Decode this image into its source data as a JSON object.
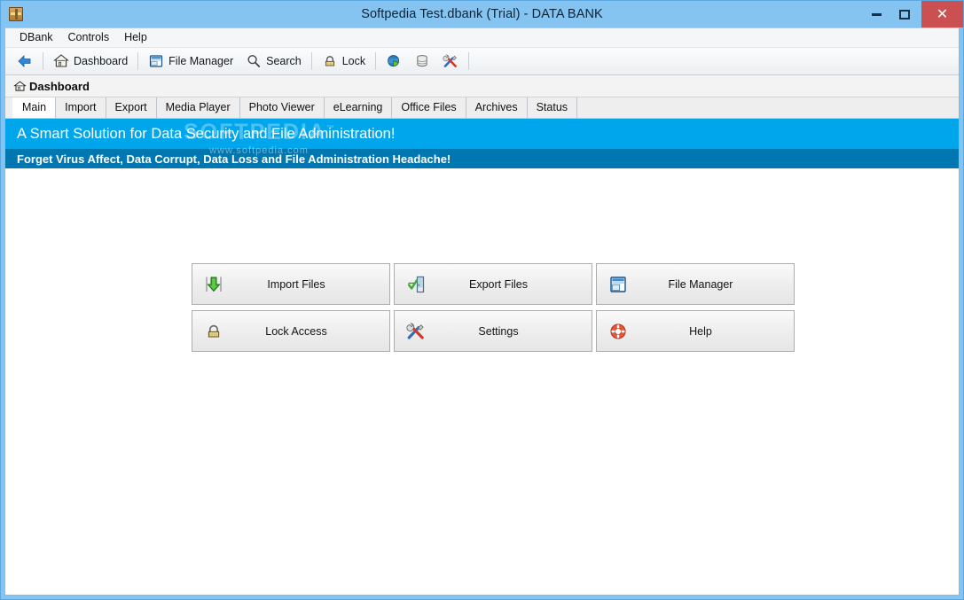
{
  "window": {
    "title": "Softpedia Test.dbank (Trial) - DATA BANK",
    "app_icon": "databank-chest-icon",
    "controls": {
      "minimize": "–",
      "maximize": "□",
      "close": "✕"
    },
    "colors": {
      "titlebar": "#85c3f0",
      "close_button": "#cb5052",
      "banner_top": "#00a6ec",
      "banner_bottom": "#0077b0",
      "frame_border": "#5ba7e0"
    }
  },
  "menubar": {
    "items": [
      {
        "label": "DBank"
      },
      {
        "label": "Controls"
      },
      {
        "label": "Help"
      }
    ]
  },
  "toolbar": {
    "items": [
      {
        "label": "",
        "icon": "back-arrow-icon",
        "type": "icon"
      },
      {
        "type": "separator"
      },
      {
        "label": "Dashboard",
        "icon": "home-icon",
        "type": "button"
      },
      {
        "type": "separator"
      },
      {
        "label": "File Manager",
        "icon": "file-manager-icon",
        "type": "button"
      },
      {
        "label": "Search",
        "icon": "search-icon",
        "type": "button"
      },
      {
        "type": "separator"
      },
      {
        "label": "Lock",
        "icon": "lock-icon",
        "type": "button"
      },
      {
        "type": "separator"
      },
      {
        "label": "",
        "icon": "globe-chart-icon",
        "type": "icon"
      },
      {
        "label": "",
        "icon": "database-icon",
        "type": "icon"
      },
      {
        "label": "",
        "icon": "tools-icon",
        "type": "icon"
      },
      {
        "type": "separator"
      }
    ]
  },
  "breadcrumb": {
    "icon": "home-icon",
    "label": "Dashboard"
  },
  "tabs": [
    {
      "label": "Main",
      "active": true
    },
    {
      "label": "Import",
      "active": false
    },
    {
      "label": "Export",
      "active": false
    },
    {
      "label": "Media Player",
      "active": false
    },
    {
      "label": "Photo Viewer",
      "active": false
    },
    {
      "label": "eLearning",
      "active": false
    },
    {
      "label": "Office Files",
      "active": false
    },
    {
      "label": "Archives",
      "active": false
    },
    {
      "label": "Status",
      "active": false
    }
  ],
  "banner": {
    "headline": "A Smart Solution for Data Security and File Administration!",
    "subhead": "Forget Virus Affect, Data Corrupt, Data Loss and File Administration Headache!",
    "watermark_main": "SOFTPEDIA",
    "watermark_tm": "™",
    "watermark_sub": "www.softpedia.com"
  },
  "dashboard_buttons": [
    {
      "label": "Import Files",
      "icon": "import-down-arrow-icon"
    },
    {
      "label": "Export Files",
      "icon": "export-door-icon"
    },
    {
      "label": "File Manager",
      "icon": "file-manager-icon"
    },
    {
      "label": "Lock Access",
      "icon": "padlock-icon"
    },
    {
      "label": "Settings",
      "icon": "tools-icon"
    },
    {
      "label": "Help",
      "icon": "lifebuoy-icon"
    }
  ]
}
